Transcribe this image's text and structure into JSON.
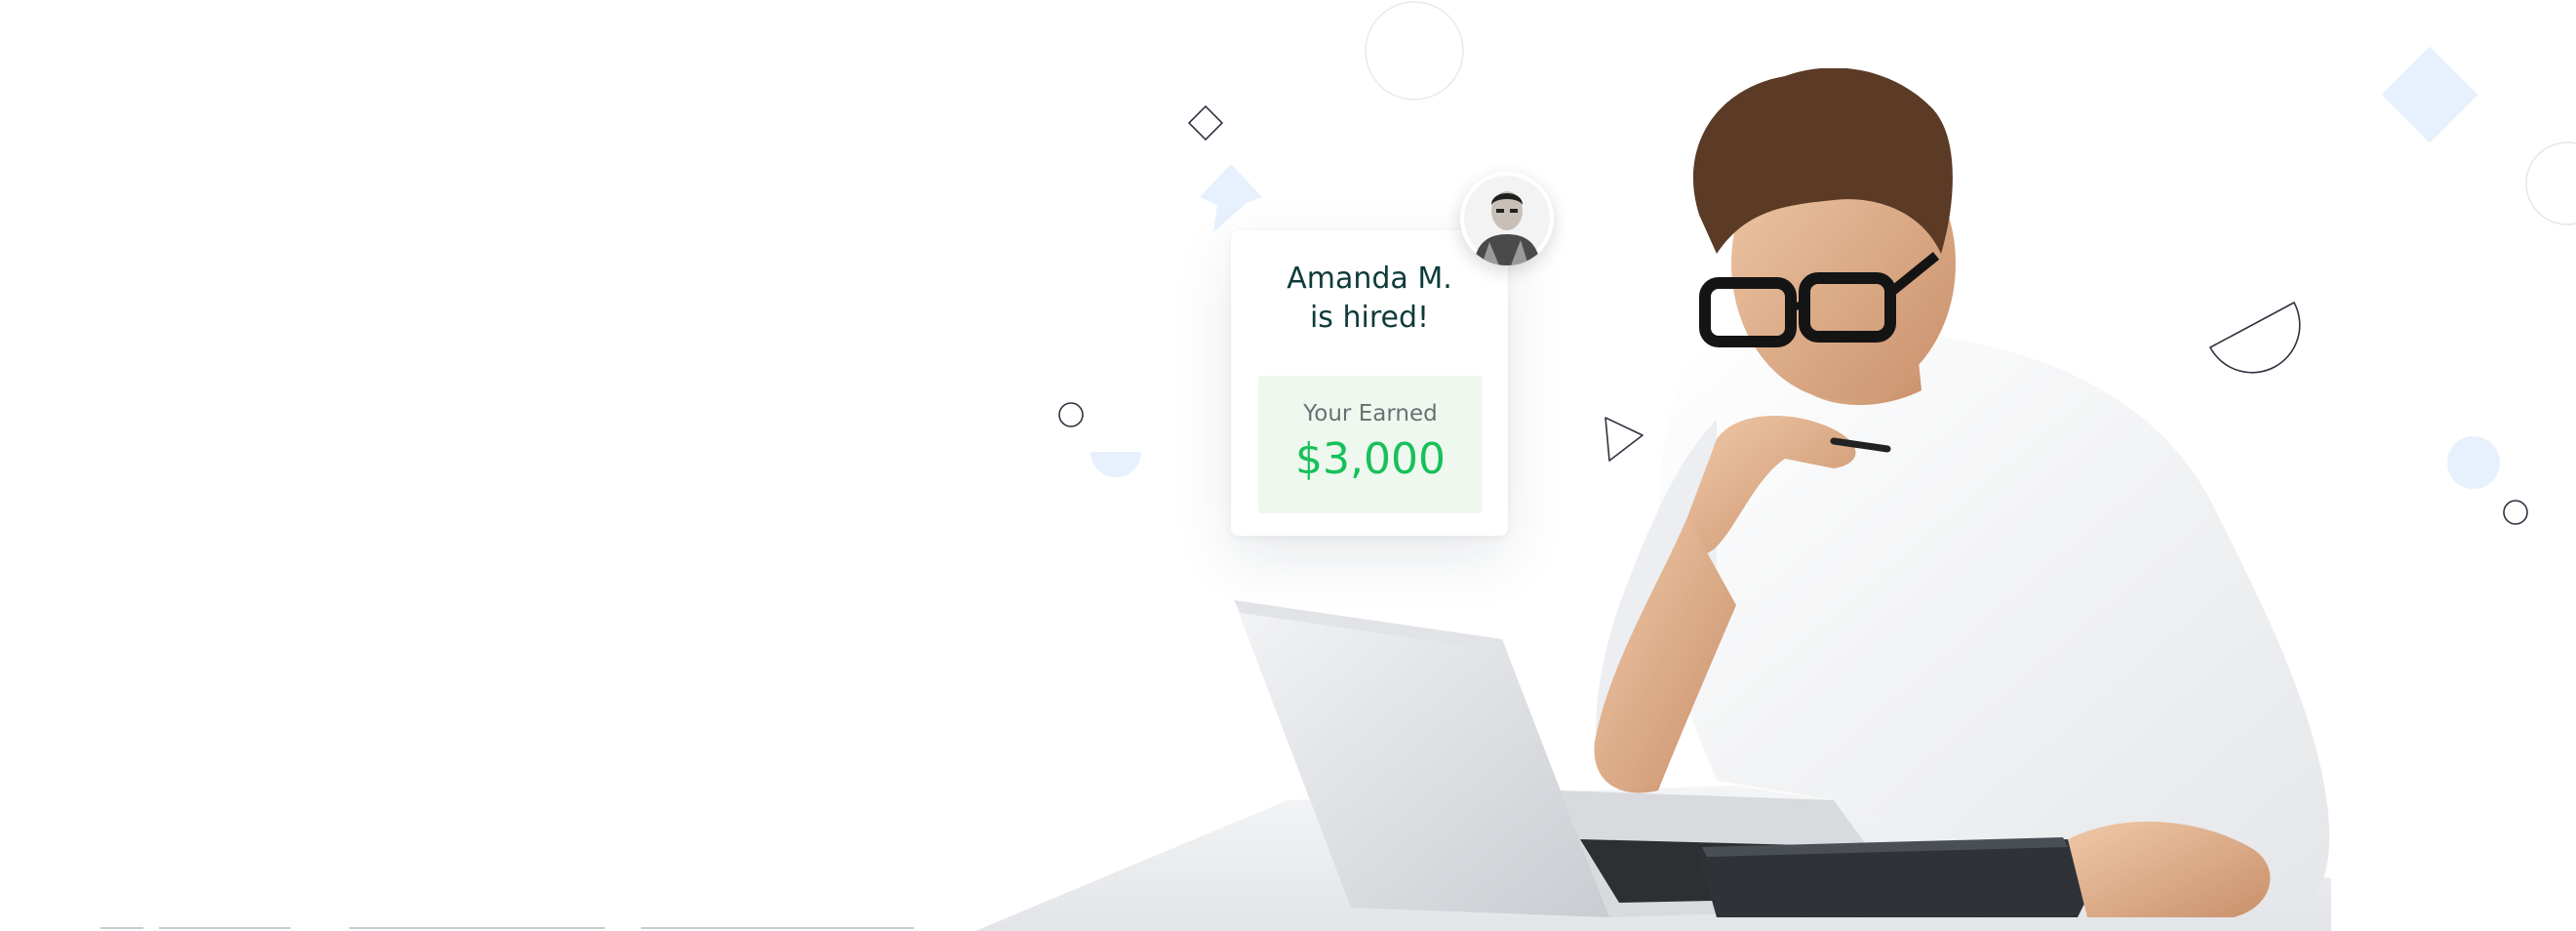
{
  "hire_card": {
    "title_line1": "Amanda M.",
    "title_line2": "is hired!",
    "earned_label": "Your Earned",
    "earned_amount": "$3,000"
  },
  "avatar": {
    "icon": "profile-photo"
  },
  "hero_photo": {
    "icon": "man-with-glasses-laptop-photo"
  },
  "colors": {
    "accent_green": "#18c05a",
    "title_dark": "#0e3b3a",
    "shape_blue": "#e8f2fd",
    "outline": "#2d3340"
  }
}
